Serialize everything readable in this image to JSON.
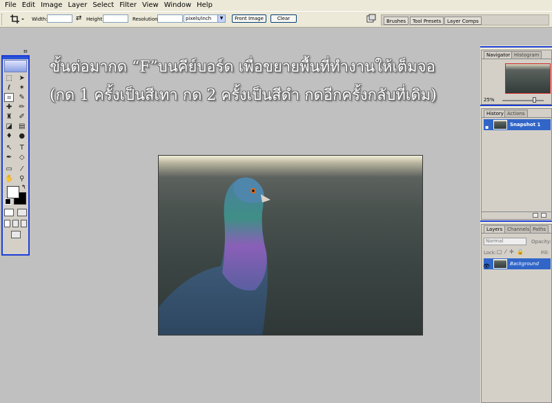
{
  "menu": [
    "File",
    "Edit",
    "Image",
    "Layer",
    "Select",
    "Filter",
    "View",
    "Window",
    "Help"
  ],
  "options_bar": {
    "width_label": "Width:",
    "height_label": "Height:",
    "resolution_label": "Resolution:",
    "resolution_unit": "pixels/inch",
    "front_image_label": "Front Image",
    "clear_label": "Clear"
  },
  "palette_well": {
    "tabs": [
      "Brushes",
      "Tool Presets",
      "Layer Comps"
    ]
  },
  "instruction": {
    "line1": "ขั้นต่อมากด “F”บนคีย์บอร์ด เพื่อขยายพื้นที่ทำงานให้เต็มจอ",
    "line2": "(กด 1 ครั้งเป็นสีเทา กด 2 ครั้งเป็นสีดำ กดอีกครั้งกลับที่เดิม)"
  },
  "navigator": {
    "tabs": [
      "Navigator",
      "Histogram"
    ],
    "zoom": "25%"
  },
  "history": {
    "tabs": [
      "History",
      "Actions"
    ],
    "snapshot_label": "Snapshot 1"
  },
  "layers": {
    "tabs": [
      "Layers",
      "Channels",
      "Paths"
    ],
    "blend_mode": "Normal",
    "opacity_label": "Opacity:",
    "lock_label": "Lock:",
    "fill_label": "Fill:",
    "layer_name": "Background"
  },
  "colors": {
    "accent": "#2855d8",
    "selected_row": "#3166c8",
    "workspace": "#c0c0c0"
  }
}
